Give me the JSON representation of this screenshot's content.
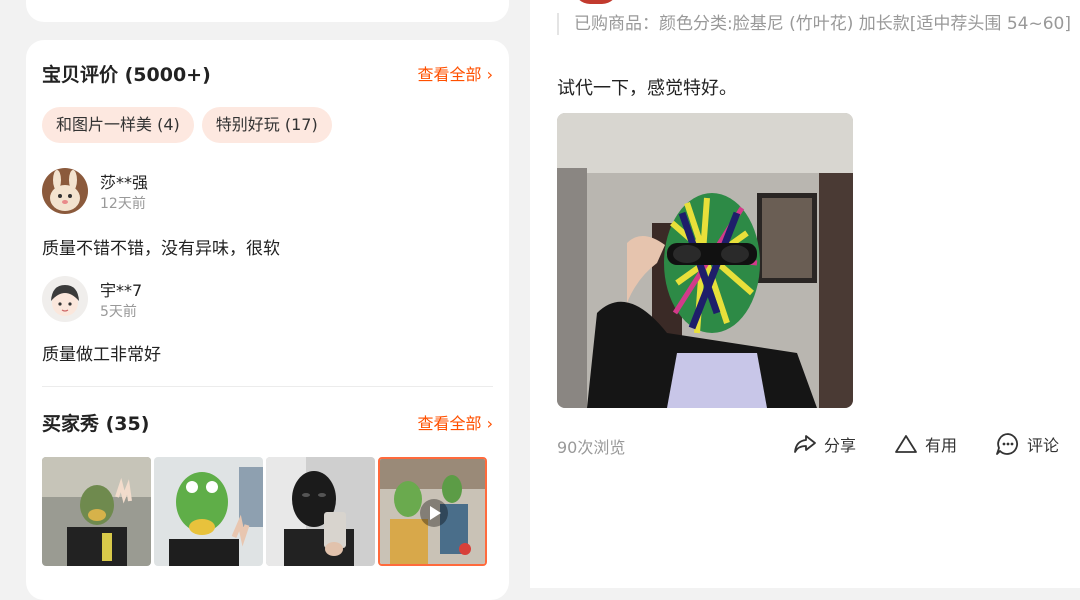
{
  "reviews_section": {
    "title": "宝贝评价 (5000+)",
    "view_all": "查看全部 ›",
    "tags": [
      "和图片一样美 (4)",
      "特别好玩 (17)"
    ],
    "reviews": [
      {
        "user": "莎**强",
        "date": "12天前",
        "text": "质量不错不错，没有异味，很软"
      },
      {
        "user": "宇**7",
        "date": "5天前",
        "text": "质量做工非常好"
      }
    ]
  },
  "buyer_show": {
    "title": "买家秀 (35)",
    "view_all": "查看全部 ›"
  },
  "review_detail": {
    "purchased": "已购商品：颜色分类:脸基尼 (竹叶花) 加长款[适中荐头围 54~60]",
    "text": "试代一下，感觉特好。",
    "views": "90次浏览",
    "actions": {
      "share": "分享",
      "useful": "有用",
      "comment": "评论"
    }
  },
  "colors": {
    "accent": "#ff5000",
    "tag_bg": "#fde8e0"
  }
}
